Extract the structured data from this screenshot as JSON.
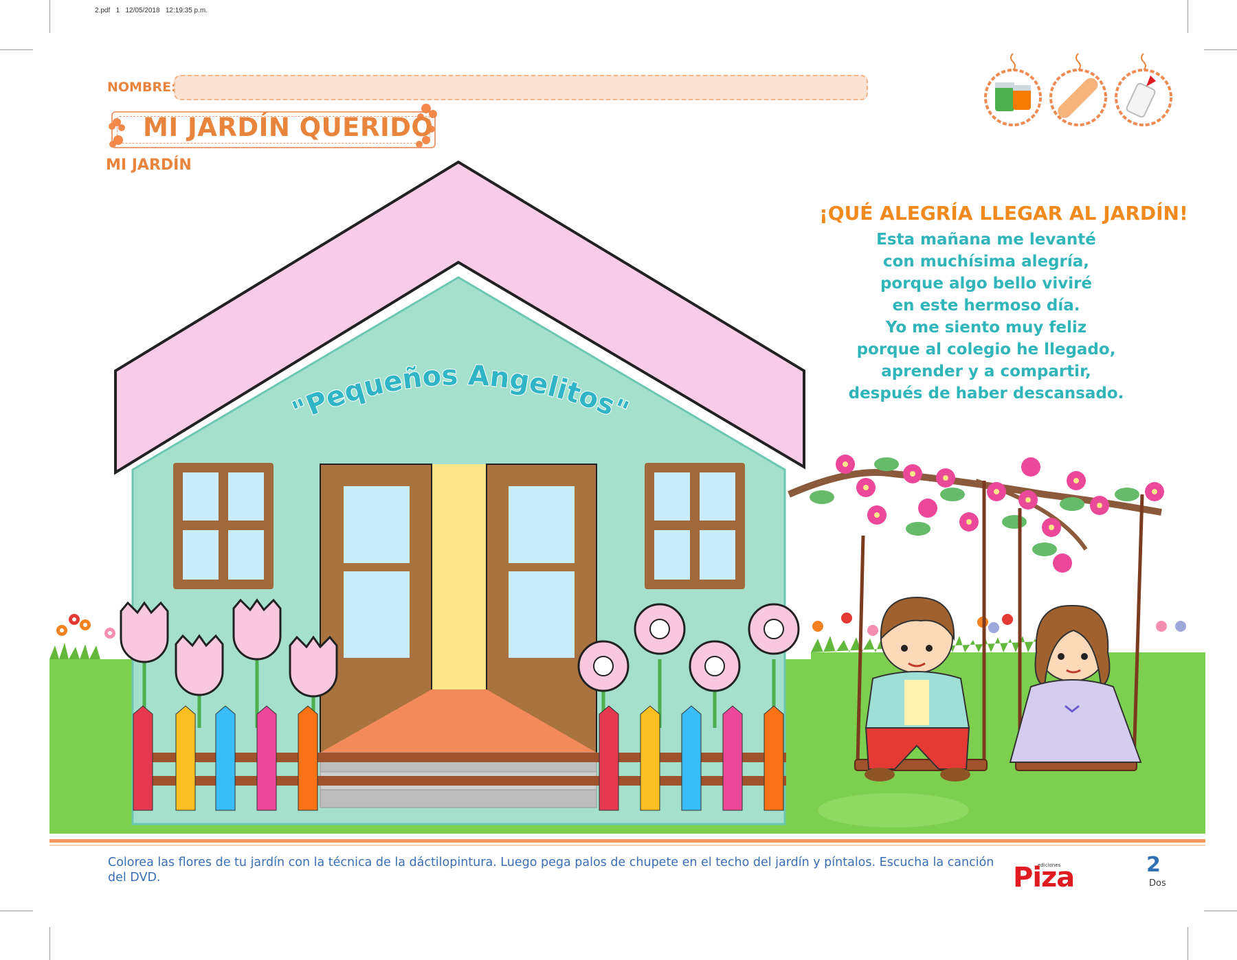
{
  "print_meta": "2.pdf   1   12/05/2018   12:19:35 p.m.",
  "header": {
    "name_label": "NOMBRE:",
    "title": "MI JARDÍN QUERIDO",
    "subtitle": "MI JARDÍN"
  },
  "materials": {
    "icons": [
      "paint-jars-icon",
      "popsicle-stick-icon",
      "glue-bottle-icon"
    ]
  },
  "house": {
    "sign": "\"Pequeños Angelitos\""
  },
  "poem": {
    "title": "¡QUÉ ALEGRÍA LLEGAR AL JARDÍN!",
    "lines": [
      "Esta mañana me levanté",
      "con muchísima alegría,",
      "porque algo bello viviré",
      "en este hermoso día.",
      "Yo me siento muy feliz",
      "porque al colegio he llegado,",
      "aprender y a compartir,",
      "después de haber descansado."
    ]
  },
  "footer": {
    "instructions": "Colorea las flores de tu jardín con la técnica de la dáctilopintura. Luego pega palos de chupete en el techo del jardín y píntalos. Escucha la canción del DVD.",
    "publisher_small": "ediciones",
    "publisher": "Piza",
    "page_number": "2",
    "page_word": "Dos"
  },
  "colors": {
    "accent_orange": "#e8843c",
    "poem_teal": "#2fb5ba",
    "footer_blue": "#3a6fb4",
    "roof_pink": "#f8cbe6",
    "wall_mint": "#a5e0cc",
    "grass_green": "#7ccf4f"
  }
}
